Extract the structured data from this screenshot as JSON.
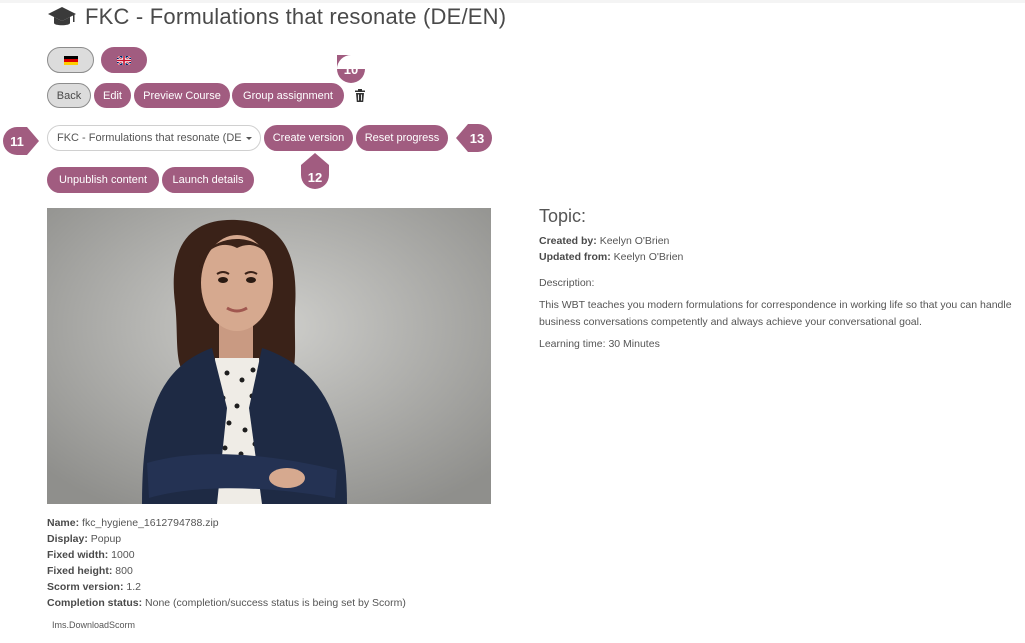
{
  "page": {
    "title": "FKC - Formulations that resonate (DE/EN)",
    "title_icon": "graduation-cap-icon"
  },
  "languages": [
    {
      "name": "german-flag",
      "selected": true
    },
    {
      "name": "uk-flag",
      "selected": false
    }
  ],
  "toolbar": {
    "back": "Back",
    "edit": "Edit",
    "preview": "Preview Course",
    "group_assignment": "Group assignment",
    "delete_icon": "trash-icon"
  },
  "version_bar": {
    "version_select": "FKC - Formulations that resonate (DE",
    "create_version": "Create version",
    "reset_progress": "Reset progress"
  },
  "actions": {
    "unpublish": "Unpublish content",
    "launch_details": "Launch details"
  },
  "markers": {
    "m10": "10",
    "m11": "11",
    "m12": "12",
    "m13": "13"
  },
  "package_info": {
    "name_label": "Name:",
    "name_value": "fkc_hygiene_1612794788.zip",
    "display_label": "Display:",
    "display_value": "Popup",
    "width_label": "Fixed width:",
    "width_value": "1000",
    "height_label": "Fixed height:",
    "height_value": "800",
    "scorm_label": "Scorm version:",
    "scorm_value": "1.2",
    "completion_label": "Completion status:",
    "completion_value": "None (completion/success status is being set by Scorm)",
    "ims": "Ims.DownloadScorm"
  },
  "topic": {
    "heading": "Topic:",
    "created_label": "Created by:",
    "created_value": "Keelyn O'Brien",
    "updated_label": "Updated from:",
    "updated_value": "Keelyn O'Brien",
    "description_label": "Description:",
    "description": "This WBT teaches you modern formulations for correspondence in working life so that you can handle business conversations competently and always achieve your conversational goal.",
    "learning_time": "Learning time: 30 Minutes"
  },
  "colors": {
    "accent": "#a15c80",
    "text": "#4a4a4a",
    "button_grey": "#dcdcdc"
  }
}
